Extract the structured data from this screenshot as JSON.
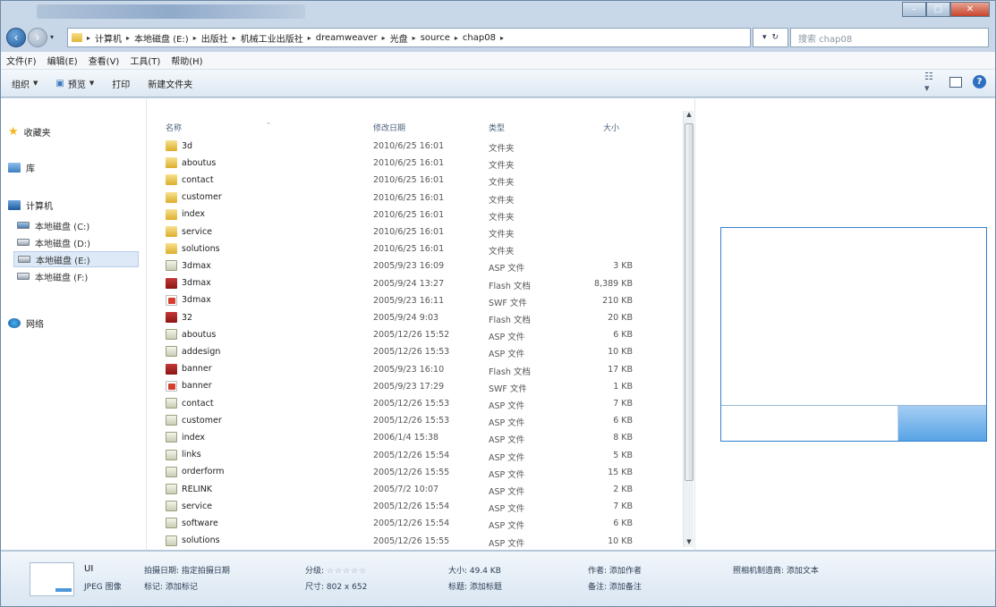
{
  "titlebar": {
    "min_glyph": "–",
    "max_glyph": "□",
    "close_glyph": "✕"
  },
  "address": {
    "crumbs": [
      "计算机",
      "本地磁盘 (E:)",
      "出版社",
      "机械工业出版社",
      "dreamweaver",
      "光盘",
      "source",
      "chap08"
    ]
  },
  "search": {
    "placeholder": "搜索 chap08"
  },
  "menubar": {
    "items": [
      "文件(F)",
      "编辑(E)",
      "查看(V)",
      "工具(T)",
      "帮助(H)"
    ]
  },
  "toolbar": {
    "organize": "组织",
    "preview": "预览",
    "print": "打印",
    "new_folder": "新建文件夹"
  },
  "navpane": {
    "favorites": "收藏夹",
    "libraries": "库",
    "computer": "计算机",
    "drives": [
      "本地磁盘 (C:)",
      "本地磁盘 (D:)",
      "本地磁盘 (E:)",
      "本地磁盘 (F:)"
    ],
    "network": "网络"
  },
  "columns": {
    "name": "名称",
    "date": "修改日期",
    "type": "类型",
    "size": "大小"
  },
  "files": [
    {
      "name": "3d",
      "date": "2010/6/25 16:01",
      "type": "文件夹",
      "size": "",
      "icon": "folder-icon"
    },
    {
      "name": "aboutus",
      "date": "2010/6/25 16:01",
      "type": "文件夹",
      "size": "",
      "icon": "folder-icon"
    },
    {
      "name": "contact",
      "date": "2010/6/25 16:01",
      "type": "文件夹",
      "size": "",
      "icon": "folder-icon"
    },
    {
      "name": "customer",
      "date": "2010/6/25 16:01",
      "type": "文件夹",
      "size": "",
      "icon": "folder-icon"
    },
    {
      "name": "index",
      "date": "2010/6/25 16:01",
      "type": "文件夹",
      "size": "",
      "icon": "folder-icon"
    },
    {
      "name": "service",
      "date": "2010/6/25 16:01",
      "type": "文件夹",
      "size": "",
      "icon": "folder-icon"
    },
    {
      "name": "solutions",
      "date": "2010/6/25 16:01",
      "type": "文件夹",
      "size": "",
      "icon": "folder-icon"
    },
    {
      "name": "3dmax",
      "date": "2005/9/23 16:09",
      "type": "ASP 文件",
      "size": "3 KB",
      "icon": "asp-file-icon"
    },
    {
      "name": "3dmax",
      "date": "2005/9/24 13:27",
      "type": "Flash 文档",
      "size": "8,389 KB",
      "icon": "flash-document-icon"
    },
    {
      "name": "3dmax",
      "date": "2005/9/23 16:11",
      "type": "SWF 文件",
      "size": "210 KB",
      "icon": "swf-file-icon"
    },
    {
      "name": "32",
      "date": "2005/9/24 9:03",
      "type": "Flash 文档",
      "size": "20 KB",
      "icon": "flash-document-icon"
    },
    {
      "name": "aboutus",
      "date": "2005/12/26 15:52",
      "type": "ASP 文件",
      "size": "6 KB",
      "icon": "asp-file-icon"
    },
    {
      "name": "addesign",
      "date": "2005/12/26 15:53",
      "type": "ASP 文件",
      "size": "10 KB",
      "icon": "asp-file-icon"
    },
    {
      "name": "banner",
      "date": "2005/9/23 16:10",
      "type": "Flash 文档",
      "size": "17 KB",
      "icon": "flash-document-icon"
    },
    {
      "name": "banner",
      "date": "2005/9/23 17:29",
      "type": "SWF 文件",
      "size": "1 KB",
      "icon": "swf-file-icon"
    },
    {
      "name": "contact",
      "date": "2005/12/26 15:53",
      "type": "ASP 文件",
      "size": "7 KB",
      "icon": "asp-file-icon"
    },
    {
      "name": "customer",
      "date": "2005/12/26 15:53",
      "type": "ASP 文件",
      "size": "6 KB",
      "icon": "asp-file-icon"
    },
    {
      "name": "index",
      "date": "2006/1/4 15:38",
      "type": "ASP 文件",
      "size": "8 KB",
      "icon": "asp-file-icon"
    },
    {
      "name": "links",
      "date": "2005/12/26 15:54",
      "type": "ASP 文件",
      "size": "5 KB",
      "icon": "asp-file-icon"
    },
    {
      "name": "orderform",
      "date": "2005/12/26 15:55",
      "type": "ASP 文件",
      "size": "15 KB",
      "icon": "asp-file-icon"
    },
    {
      "name": "RELINK",
      "date": "2005/7/2 10:07",
      "type": "ASP 文件",
      "size": "2 KB",
      "icon": "asp-file-icon"
    },
    {
      "name": "service",
      "date": "2005/12/26 15:54",
      "type": "ASP 文件",
      "size": "7 KB",
      "icon": "asp-file-icon"
    },
    {
      "name": "software",
      "date": "2005/12/26 15:54",
      "type": "ASP 文件",
      "size": "6 KB",
      "icon": "asp-file-icon"
    },
    {
      "name": "solutions",
      "date": "2005/12/26 15:55",
      "type": "ASP 文件",
      "size": "10 KB",
      "icon": "asp-file-icon"
    }
  ],
  "details": {
    "filename": "UI",
    "filetype": "JPEG 图像",
    "date_taken_label": "拍摄日期: 指定拍摄日期",
    "tags_label": "标记: 添加标记",
    "rating_label": "分级:",
    "rating_stars": "☆☆☆☆☆",
    "dimensions_label": "尺寸: 802 x 652",
    "size_label": "大小: 49.4 KB",
    "title_label": "标题: 添加标题",
    "author_label": "作者: 添加作者",
    "comments_label": "备注: 添加备注",
    "camera_label": "照相机制造商: 添加文本"
  }
}
